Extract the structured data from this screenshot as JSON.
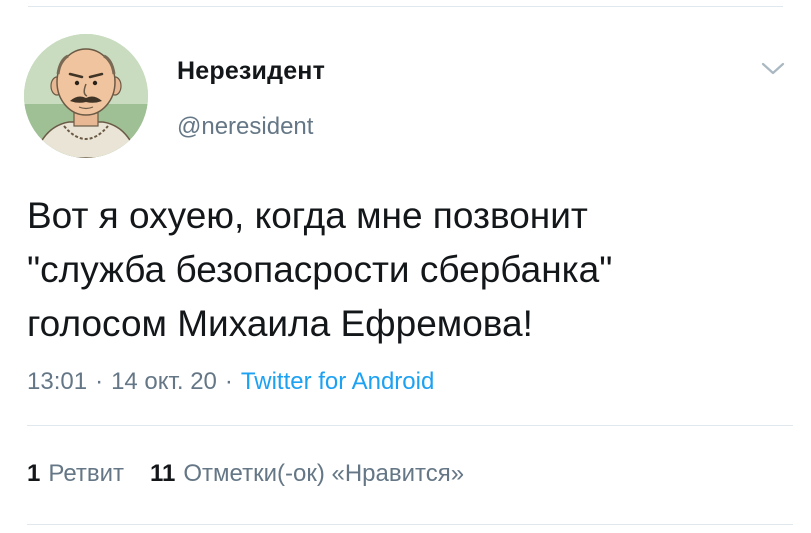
{
  "tweet": {
    "author": {
      "display_name": "Нерезидент",
      "handle": "@neresident",
      "avatar_icon": "cartoon-man-avatar"
    },
    "text": "Вот я охуею, когда мне позвонит\n\"служба безопасрости сбербанка\"\nголосом Михаила Ефремова!",
    "meta": {
      "time": "13:01",
      "separator": "·",
      "date": "14 окт. 20",
      "source": "Twitter for Android"
    },
    "stats": {
      "retweets_count": "1",
      "retweets_label": "Ретвит",
      "likes_count": "11",
      "likes_label": "Отметки(-ок) «Нравится»"
    },
    "menu_icon": "chevron-down-icon",
    "colors": {
      "link": "#1da1f2",
      "secondary_text": "#657786",
      "primary_text": "#14171a",
      "divider": "#e1e8ed"
    }
  }
}
